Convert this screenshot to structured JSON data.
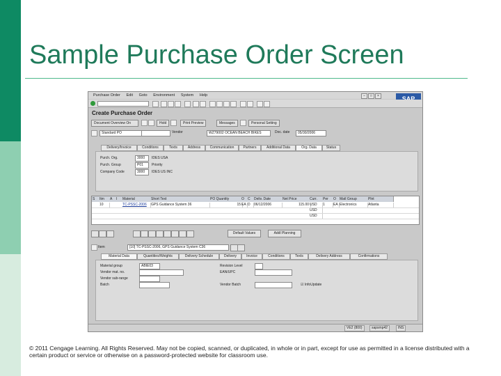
{
  "slide": {
    "title": "Sample Purchase Order Screen",
    "copyright": "© 2011 Cengage Learning. All Rights Reserved. May not be copied, scanned, or duplicated, in whole or in part, except for use as permitted in a license distributed with a certain product or service or otherwise on a password-protected website for classroom use."
  },
  "sap": {
    "menu": [
      "Purchase Order",
      "Edit",
      "Goto",
      "Environment",
      "System",
      "Help"
    ],
    "screen_title": "Create Purchase Order",
    "logo": "SAP",
    "app_toolbar": {
      "doc_overview": "Document Overview On",
      "hold": "Hold",
      "print_preview": "Print Preview",
      "messages": "Messages",
      "personal_setting": "Personal Setting"
    },
    "header": {
      "po_type": "Standard PO",
      "vendor_label": "Vendor",
      "vendor_value": "WZ79002 OCEAN BEACH BIKES",
      "doc_date_label": "Doc. date",
      "doc_date_value": "05/30/2006"
    },
    "header_tabs": [
      "Delivery/Invoice",
      "Conditions",
      "Texts",
      "Address",
      "Communication",
      "Partners",
      "Additional Data",
      "Org. Data",
      "Status"
    ],
    "org_data": {
      "purch_org_label": "Purch. Org.",
      "purch_org_code": "3000",
      "purch_org_name": "IDES USA",
      "purch_group_label": "Purch. Group",
      "purch_group_code": "P01",
      "purch_group_name": "Priority",
      "company_code_label": "Company Code",
      "company_code_code": "3000",
      "company_code_name": "IDES US INC"
    },
    "items": {
      "columns": [
        "S",
        "Itm",
        "A",
        "I",
        "Material",
        "Short Text",
        "PO Quantity",
        "O",
        "C",
        "Deliv. Date",
        "Net Price",
        "Curr.",
        "Per",
        "O",
        "Matl Group",
        "Plnt"
      ],
      "rows": [
        {
          "itm": "10",
          "material": "TC-PSSC-2006",
          "short_text": "GPS Guidance System 36",
          "qty": "15",
          "unit": "EA",
          "c": "D",
          "deliv_date": "06/12/2006",
          "net_price": "115.00",
          "curr": "USD",
          "per": "1",
          "o": "EA",
          "matl_group": "Electronics",
          "plnt": "Atlanta"
        },
        {
          "curr": "USD"
        },
        {
          "curr": "USD"
        }
      ]
    },
    "grid_buttons": {
      "default_values": "Default Values",
      "addl_planning": "Addl Planning"
    },
    "item_detail": {
      "item_label": "Item",
      "item_value": "[10] TC-PSSC-2006, GPS Guidance System C36"
    },
    "item_tabs": [
      "Material Data",
      "Quantities/Weights",
      "Delivery Schedule",
      "Delivery",
      "Invoice",
      "Conditions",
      "Texts",
      "Delivery Address",
      "Confirmations"
    ],
    "material_data": {
      "matl_group_label": "Material group",
      "matl_group_value": "ABIE03",
      "vendor_mat_label": "Vendor mat. no.",
      "vendor_sub_label": "Vendor sub-range",
      "batch_label": "Batch",
      "rev_level_label": "Revision Level",
      "ean_label": "EAN/UPC",
      "vendor_batch_label": "Vendor Batch",
      "info_update_label": "InfoUpdate"
    },
    "status_bar": {
      "system": "VE2 (800)",
      "server": "sapsmp42",
      "mode": "INS"
    }
  }
}
